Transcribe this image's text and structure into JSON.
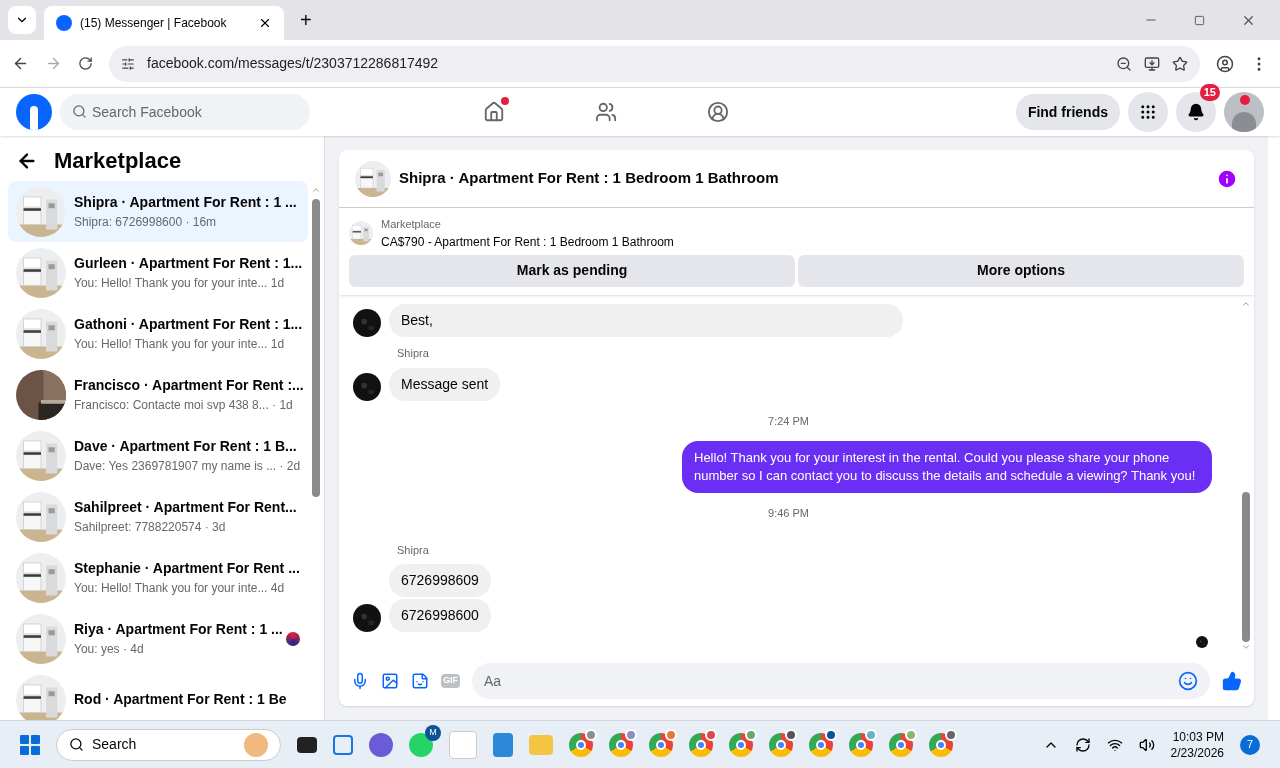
{
  "browser": {
    "tab_title": "(15) Messenger | Facebook",
    "new_tab": "+",
    "url": "facebook.com/messages/t/2303712286817492"
  },
  "header": {
    "search_placeholder": "Search Facebook",
    "home_unread": true,
    "find_friends": "Find friends",
    "notification_count": "15",
    "profile_unread": true
  },
  "sidebar": {
    "title": "Marketplace",
    "conversations": [
      {
        "title": "Shipra · Apartment For Rent : 1 ...",
        "preview": "Shipra: 6726998600 · 16m",
        "selected": true,
        "seen_avatar": false
      },
      {
        "title": "Gurleen · Apartment For Rent : 1...",
        "preview": "You: Hello! Thank you for your inte...  1d",
        "selected": false,
        "seen_avatar": false
      },
      {
        "title": "Gathoni · Apartment For Rent : 1...",
        "preview": "You: Hello! Thank you for your inte...  1d",
        "selected": false,
        "seen_avatar": false
      },
      {
        "title": "Francisco · Apartment For Rent :...",
        "preview": "Francisco: Contacte moi svp 438 8... · 1d",
        "selected": false,
        "seen_avatar": false
      },
      {
        "title": "Dave · Apartment For Rent : 1 B...",
        "preview": "Dave: Yes 2369781907 my name is ... · 2d",
        "selected": false,
        "seen_avatar": false
      },
      {
        "title": "Sahilpreet · Apartment For Rent...",
        "preview": "Sahilpreet: 7788220574 · 3d",
        "selected": false,
        "seen_avatar": false
      },
      {
        "title": "Stephanie · Apartment For Rent ...",
        "preview": "You: Hello! Thank you for your inte...  4d",
        "selected": false,
        "seen_avatar": false
      },
      {
        "title": "Riya · Apartment For Rent : 1 ...",
        "preview": "You: yes · 4d",
        "selected": false,
        "seen_avatar": true
      },
      {
        "title": "Rod · Apartment For Rent : 1 Be",
        "selected": false,
        "seen_avatar": false
      }
    ]
  },
  "chat": {
    "title": "Shipra · Apartment For Rent : 1 Bedroom 1 Bathroom",
    "listing_label": "Marketplace",
    "listing": "CA$790 - Apartment For Rent : 1 Bedroom 1 Bathroom",
    "buttons": [
      "Mark as pending",
      "More options"
    ],
    "messages": [
      {
        "kind": "incoming",
        "text": "Best,",
        "avatar": true
      },
      {
        "kind": "sender",
        "text": "Shipra"
      },
      {
        "kind": "incoming",
        "text": "Message sent",
        "avatar": true
      },
      {
        "kind": "time",
        "text": "7:24 PM"
      },
      {
        "kind": "outgoing",
        "text": "Hello! Thank you for your interest in the rental. Could you please share your phone number so I can contact you to discuss the details and schedule a viewing? Thank you!"
      },
      {
        "kind": "time",
        "text": "9:46 PM"
      },
      {
        "kind": "sender",
        "text": "Shipra"
      },
      {
        "kind": "incoming",
        "text": "6726998609",
        "avatar": false
      },
      {
        "kind": "incoming",
        "text": "6726998600",
        "avatar": true
      }
    ],
    "composer_placeholder": "Aa",
    "gif": "GIF"
  },
  "taskbar": {
    "search": "Search",
    "badge_letter": "M",
    "time": "10:03 PM",
    "date": "2/23/2026",
    "notifications": "7"
  }
}
